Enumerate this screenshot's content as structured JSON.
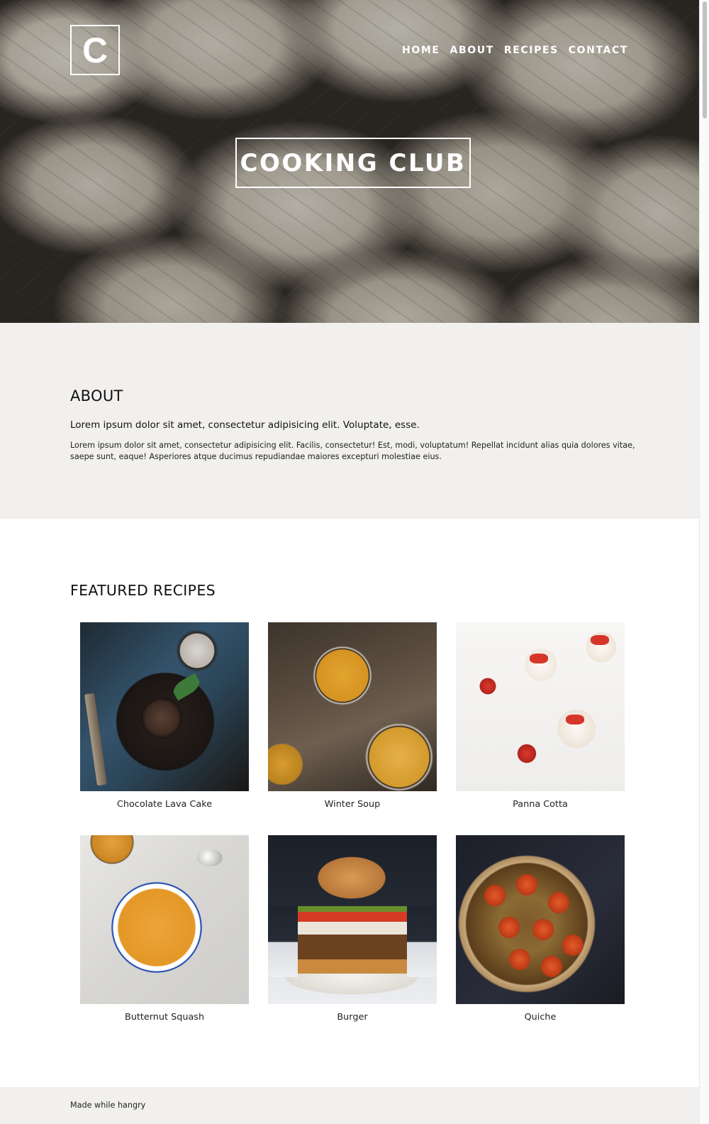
{
  "header": {
    "logo_letter": "C",
    "nav": [
      "HOME",
      "ABOUT",
      "RECIPES",
      "CONTACT"
    ],
    "hero_title": "COOKING CLUB"
  },
  "about": {
    "heading": "ABOUT",
    "lead": "Lorem ipsum dolor sit amet, consectetur adipisicing elit. Voluptate, esse.",
    "body": "Lorem ipsum dolor sit amet, consectetur adipisicing elit. Facilis, consectetur! Est, modi, voluptatum! Repellat incidunt alias quia dolores vitae, saepe sunt, eaque! Asperiores atque ducimus repudiandae maiores excepturi molestiae eius."
  },
  "featured": {
    "heading": "FEATURED RECIPES",
    "recipes": [
      "Chocolate Lava Cake",
      "Winter Soup",
      "Panna Cotta",
      "Butternut Squash",
      "Burger",
      "Quiche"
    ]
  },
  "footer": {
    "text": "Made while hangry"
  }
}
